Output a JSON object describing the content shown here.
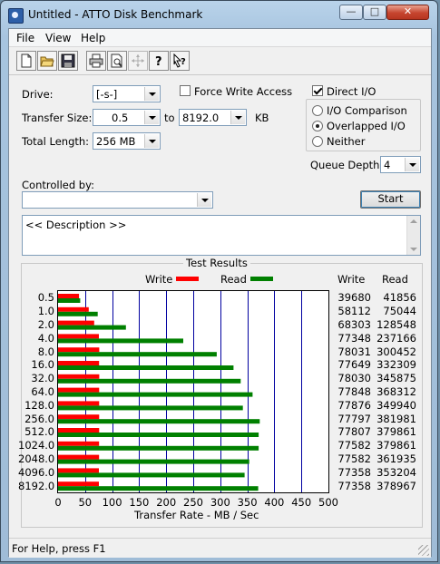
{
  "window": {
    "title": "Untitled - ATTO Disk Benchmark",
    "min_glyph": "—",
    "max_glyph": "□",
    "close_glyph": "✕"
  },
  "menu": [
    "File",
    "View",
    "Help"
  ],
  "toolbar": [
    "new-icon",
    "open-icon",
    "save-icon",
    "print-icon",
    "print-preview-icon",
    "move-icon",
    "help-icon",
    "context-help-icon"
  ],
  "form": {
    "drive_label": "Drive:",
    "drive_value": "[-s-]",
    "transfer_label": "Transfer Size:",
    "transfer_from": "0.5",
    "transfer_to_label": "to",
    "transfer_to": "8192.0",
    "transfer_unit": "KB",
    "total_label": "Total Length:",
    "total_value": "256 MB",
    "force_write_label": "Force Write Access",
    "force_write_checked": false,
    "direct_io_label": "Direct I/O",
    "direct_io_checked": true,
    "io_comparison_label": "I/O Comparison",
    "overlapped_label": "Overlapped I/O",
    "neither_label": "Neither",
    "selected_mode": "overlapped",
    "queue_label": "Queue Depth:",
    "queue_value": "4",
    "controlled_label": "Controlled by:",
    "controlled_value": "",
    "start_label": "Start",
    "description": "<< Description >>"
  },
  "colors": {
    "write": "#ff0000",
    "read": "#008000",
    "grid": "#0000a0"
  },
  "chart_data": {
    "type": "bar",
    "title": "Test Results",
    "xlabel": "Transfer Rate - MB / Sec",
    "xlim": [
      0,
      500
    ],
    "xticks": [
      "0",
      "50",
      "100",
      "150",
      "200",
      "250",
      "300",
      "350",
      "400",
      "450",
      "500"
    ],
    "legend": [
      "Write",
      "Read"
    ],
    "col_headers": [
      "Write",
      "Read"
    ],
    "categories": [
      "0.5",
      "1.0",
      "2.0",
      "4.0",
      "8.0",
      "16.0",
      "32.0",
      "64.0",
      "128.0",
      "256.0",
      "512.0",
      "1024.0",
      "2048.0",
      "4096.0",
      "8192.0"
    ],
    "series": [
      {
        "name": "Write",
        "values": [
          39680,
          58112,
          68303,
          77348,
          78031,
          77649,
          78030,
          77848,
          77876,
          77797,
          77807,
          77582,
          77582,
          77358,
          77358
        ]
      },
      {
        "name": "Read",
        "values": [
          41856,
          75044,
          128548,
          237166,
          300452,
          332309,
          345875,
          368312,
          349940,
          381981,
          379861,
          379861,
          361935,
          353204,
          378967
        ]
      }
    ]
  },
  "status": "For Help, press F1"
}
